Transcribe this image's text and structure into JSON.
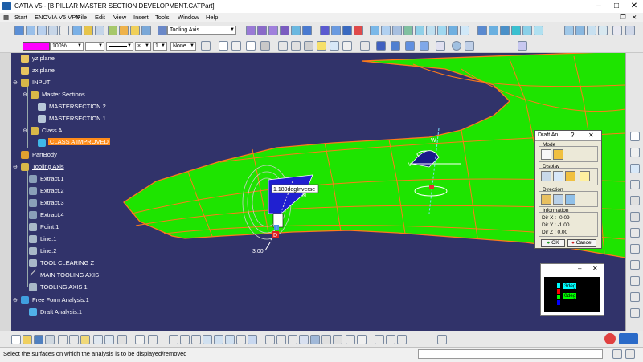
{
  "window": {
    "title": "CATIA V5 - [B PILLAR MASTER SECTION DEVELOPMENT.CATPart]",
    "minimize": "–",
    "maximize": "□",
    "close": "✕"
  },
  "menu": [
    "Start",
    "ENOVIA V5 VPM",
    "File",
    "Edit",
    "View",
    "Insert",
    "Tools",
    "Window",
    "Help"
  ],
  "toolbar": {
    "tooling_axis_combo": "Tooling Axis",
    "zoom_combo": "100%",
    "none_combo": "None",
    "line_weight_combo": "1"
  },
  "tree": [
    {
      "label": "yz plane",
      "icon": "plane-icon"
    },
    {
      "label": "zx plane",
      "icon": "plane-icon"
    },
    {
      "label": "INPUT",
      "icon": "geometrical-set-icon"
    },
    {
      "label": "Master Sections",
      "icon": "geometrical-set-icon"
    },
    {
      "label": "MASTERSECTION 2",
      "icon": "sketch-icon"
    },
    {
      "label": "MASTERSECTION 1",
      "icon": "sketch-icon"
    },
    {
      "label": "Class A",
      "icon": "geometrical-set-icon"
    },
    {
      "label": "CLASS A IMPROVED",
      "icon": "surface-icon"
    },
    {
      "label": "PartBody",
      "icon": "body-icon"
    },
    {
      "label": "Tooling Axis",
      "icon": "geometrical-set-icon"
    },
    {
      "label": "Extract.1",
      "icon": "extract-icon"
    },
    {
      "label": "Extract.2",
      "icon": "extract-icon"
    },
    {
      "label": "Extract.3",
      "icon": "extract-icon"
    },
    {
      "label": "Extract.4",
      "icon": "extract-icon"
    },
    {
      "label": "Point.1",
      "icon": "point-icon"
    },
    {
      "label": "Line.1",
      "icon": "line-icon"
    },
    {
      "label": "Line.2",
      "icon": "line-icon"
    },
    {
      "label": "TOOL CLEARING Z",
      "icon": "surface-icon"
    },
    {
      "label": "MAIN TOOLING AXIS",
      "icon": "line-icon"
    },
    {
      "label": "TOOLING AXIS 1",
      "icon": "line-icon"
    },
    {
      "label": "Free Form Analysis.1",
      "icon": "analysis-icon"
    },
    {
      "label": "Draft Analysis.1",
      "icon": "draft-analysis-icon"
    }
  ],
  "viewport": {
    "angle_label": "1.189degInverse",
    "value_label": "3.00",
    "compass_n": "N",
    "compass_w": "W",
    "marker_t": "T",
    "marker_d": "D",
    "axis_w": "W",
    "axis_v": "V"
  },
  "draft_dialog": {
    "title": "Draft An...",
    "help": "?",
    "close": "✕",
    "mode_label": "Mode",
    "display_label": "Display",
    "direction_label": "Direction",
    "information_label": "Information",
    "dir_x": "Dir X : -0.09",
    "dir_y": "Dir Y : -1.00",
    "dir_z": "Dir Z : 0.00",
    "ok": "OK",
    "cancel": "Cancel"
  },
  "legend": {
    "minimize": "–",
    "close": "✕",
    "items": [
      "3deg",
      "0deg"
    ],
    "colors": [
      "#00ffff",
      "#00ff00",
      "#ff0000",
      "#0000ff"
    ]
  },
  "statusbar": {
    "text": "Select the surfaces on which the analysis is to be displayed/removed"
  },
  "colors": {
    "viewport_bg": "#31336a",
    "surface_green": "#1ee400",
    "edge_orange": "#ff7a1a",
    "highlight_orange": "#ff8c1a"
  }
}
